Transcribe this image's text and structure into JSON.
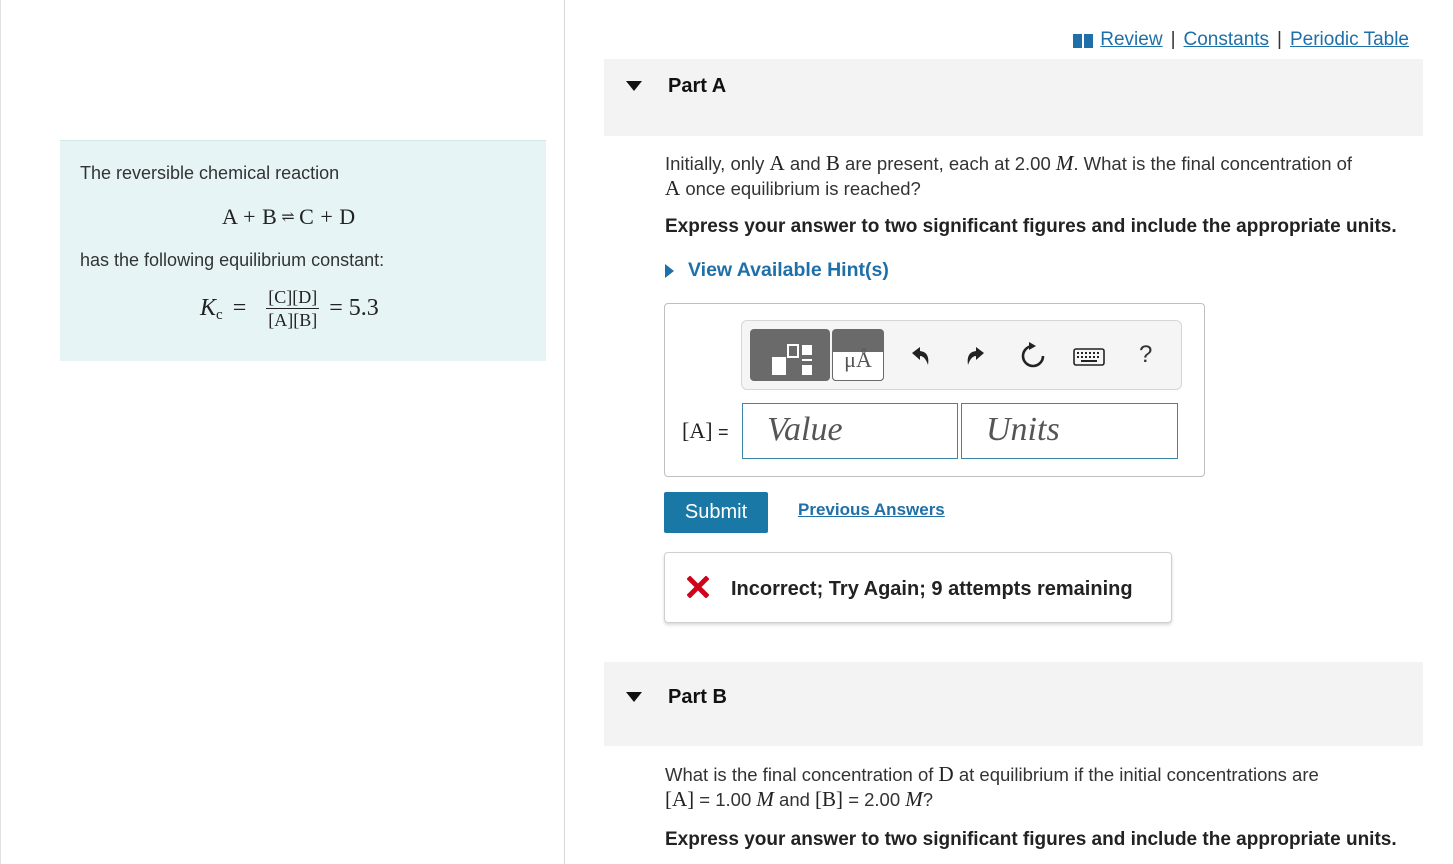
{
  "intro": {
    "line1": "The reversible chemical reaction",
    "reaction_left": "A + B",
    "reaction_right": "C + D",
    "line2": "has the following equilibrium constant:",
    "kc_symbol": "K",
    "kc_subscript": "c",
    "kc_numerator": "[C][D]",
    "kc_denominator": "[A][B]",
    "kc_value": "= 5.3"
  },
  "top_links": {
    "review": "Review",
    "constants": "Constants",
    "periodic_table": "Periodic Table",
    "separator": "|"
  },
  "part_a": {
    "title": "Part A",
    "question_pre": "Initially, only",
    "q_a": "A",
    "q_and": "and",
    "q_b": "B",
    "q_mid": "are present, each at 2.00",
    "q_m": "M",
    "q_post": ". What is the final concentration of",
    "q_a2": "A",
    "q_end": "once equilibrium is reached?",
    "instruction": "Express your answer to two significant figures and include the appropriate units.",
    "hint_label": "View Available Hint(s)",
    "answer_label": "[A]",
    "answer_equals": "=",
    "value_placeholder": "Value",
    "units_placeholder": "Units",
    "submit_label": "Submit",
    "previous_answers": "Previous Answers",
    "feedback": "Incorrect; Try Again; 9 attempts remaining",
    "help_symbol": "?",
    "units_tool_label": "μÅ"
  },
  "part_b": {
    "title": "Part B",
    "q_pre": "What is the final concentration of",
    "q_d": "D",
    "q_post": "at equilibrium if the initial concentrations are",
    "q_a": "[A]",
    "q_a_val": "= 1.00",
    "q_m1": "M",
    "q_and": "and",
    "q_b": "[B]",
    "q_b_val": "= 2.00",
    "q_m2": "M",
    "q_end": "?",
    "instruction": "Express your answer to two significant figures and include the appropriate units."
  },
  "colors": {
    "link": "#1f6fa8",
    "intro_bg": "#e6f4f6",
    "submit_bg": "#1a78a6",
    "error": "#d0021b"
  },
  "icons": [
    "book-icon",
    "caret-down-icon",
    "templates-icon",
    "units-icon",
    "undo-icon",
    "redo-icon",
    "reset-icon",
    "keyboard-icon",
    "help-icon",
    "incorrect-x-icon",
    "triangle-right-icon"
  ]
}
